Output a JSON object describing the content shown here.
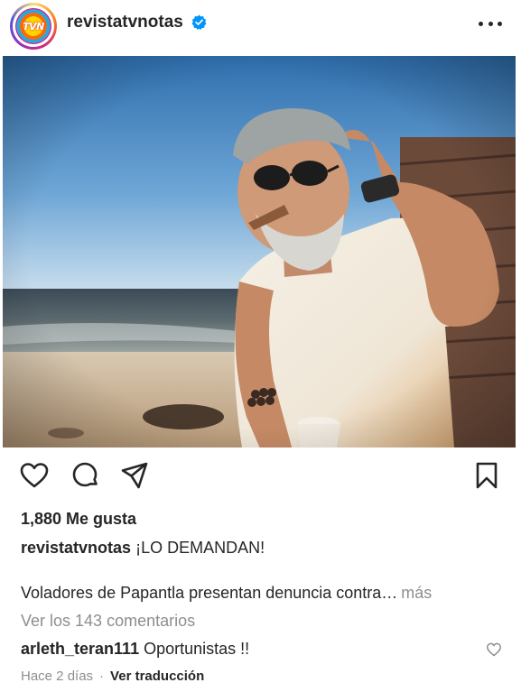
{
  "post": {
    "username": "revistatvnotas",
    "avatar_text": "TVN",
    "verified": true,
    "image_alt": "Hombre con lentes oscuros fumando un puro frente al mar",
    "likes": "1,880 Me gusta",
    "caption_user": "revistatvnotas",
    "caption_text": "¡LO DEMANDAN!",
    "body_text": "Voladores de Papantla presentan denuncia contra…",
    "more_label": "más",
    "view_comments": "Ver los 143 comentarios",
    "comment_user": "arleth_teran111",
    "comment_text": "Oportunistas !!",
    "time_ago": "Hace 2 días",
    "separator": "·",
    "translate_label": "Ver traducción"
  },
  "icons": {
    "verified": "verified-badge-icon",
    "more": "more-options-icon",
    "like": "heart-icon",
    "comment": "comment-icon",
    "share": "paper-plane-icon",
    "save": "bookmark-icon",
    "comment_like": "small-heart-icon"
  },
  "colors": {
    "text": "#262626",
    "muted": "#8e8e8e",
    "verified": "#0095f6"
  }
}
